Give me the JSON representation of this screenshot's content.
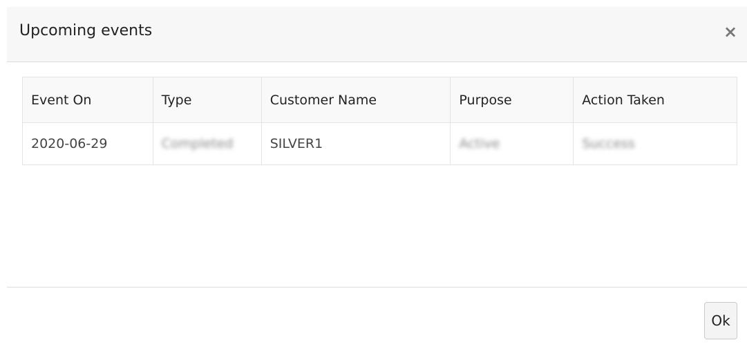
{
  "dialog": {
    "title": "Upcoming events",
    "close_icon": "×",
    "ok_label": "Ok"
  },
  "table": {
    "columns": [
      "Event On",
      "Type",
      "Customer Name",
      "Purpose",
      "Action Taken"
    ],
    "rows": [
      [
        "2020-06-29",
        "Completed",
        "SILVER1",
        "Active",
        "Success"
      ]
    ]
  }
}
